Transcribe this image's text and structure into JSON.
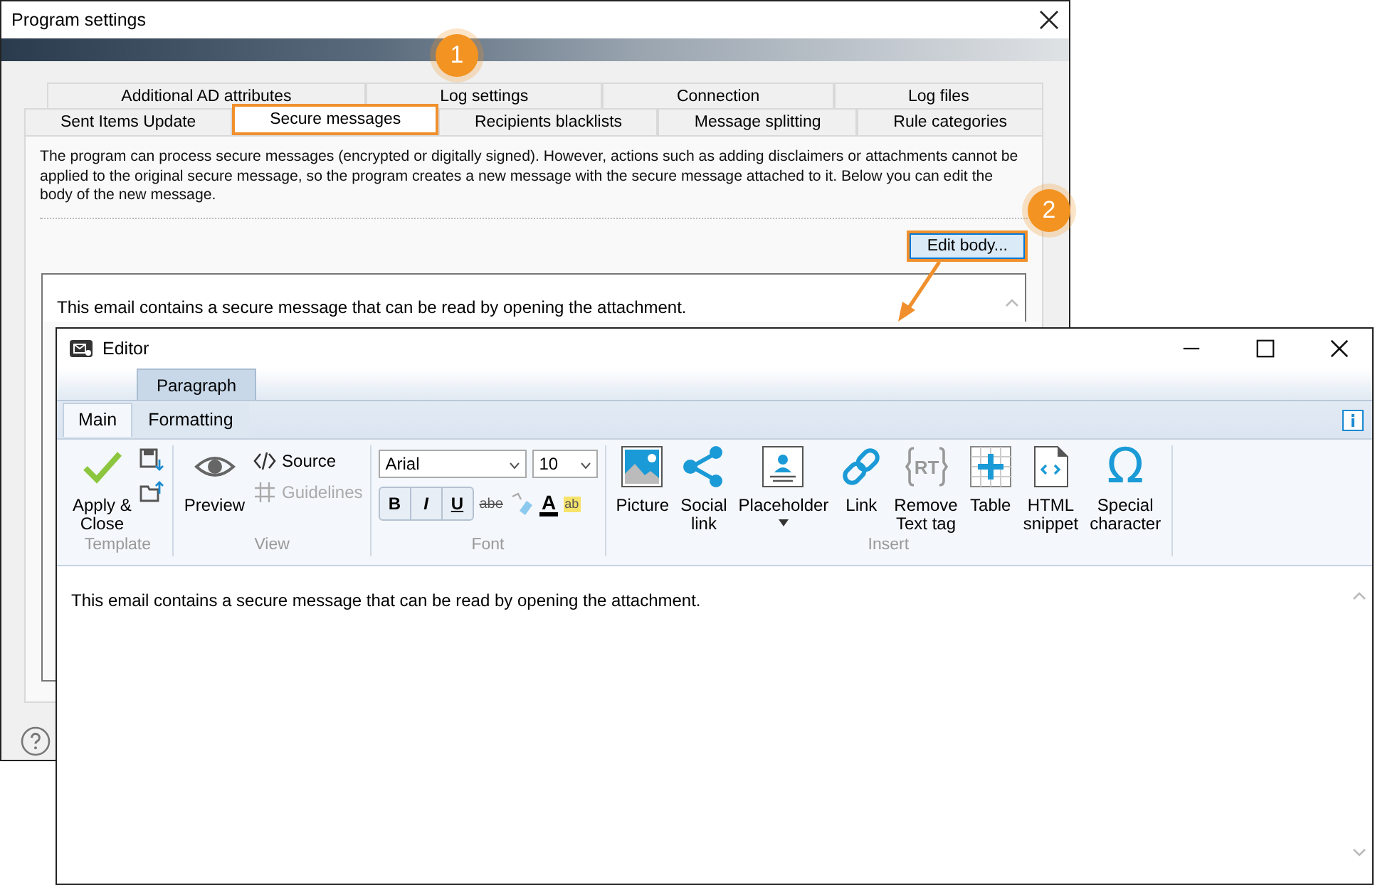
{
  "settings_window": {
    "title": "Program settings",
    "tab_rows": [
      [
        {
          "label": "Additional AD attributes",
          "selected": false
        },
        {
          "label": "Log settings",
          "selected": false
        },
        {
          "label": "Connection",
          "selected": false
        },
        {
          "label": "Log files",
          "selected": false
        }
      ],
      [
        {
          "label": "Sent Items Update",
          "selected": false
        },
        {
          "label": "Secure messages",
          "selected": true
        },
        {
          "label": "Recipients blacklists",
          "selected": false
        },
        {
          "label": "Message splitting",
          "selected": false
        },
        {
          "label": "Rule categories",
          "selected": false
        }
      ]
    ],
    "description": "The program can process secure messages (encrypted or digitally signed). However, actions such as adding disclaimers or attachments cannot be applied to the original secure message, so the program creates a new message with the secure message attached to it. Below you can edit the body of the new message.",
    "edit_button": {
      "label": "Edit body...",
      "highlighted": true
    },
    "body_preview": "This email contains a secure message that can be read by opening the attachment."
  },
  "editor_window": {
    "title": "Editor",
    "contextual_tab": "Paragraph",
    "tabs": [
      {
        "label": "Main",
        "selected": true
      },
      {
        "label": "Formatting",
        "selected": false
      }
    ],
    "groups": [
      {
        "label": "Template",
        "kind": "buttons",
        "items": [
          {
            "kind": "check",
            "label": [
              "Apply &",
              "Close"
            ]
          }
        ],
        "small_items": [
          {
            "kind": "save"
          },
          {
            "kind": "load"
          }
        ]
      },
      {
        "label": "View",
        "kind": "buttons",
        "items": [
          {
            "kind": "eye",
            "label": [
              "Preview"
            ],
            "disabled": false
          }
        ],
        "small_items": [
          {
            "kind": "code",
            "label": [
              "Source"
            ],
            "disabled": false
          },
          {
            "kind": "hash",
            "label": [
              "Guidelines"
            ],
            "disabled": true
          }
        ]
      },
      {
        "label": "Font",
        "kind": "font",
        "font": "Arial",
        "font_size": "10",
        "format": [
          "B",
          "I",
          "U"
        ],
        "strike": "abe",
        "font_color": "A",
        "highlight": "ab"
      },
      {
        "label": "Insert",
        "kind": "buttons",
        "items": [
          {
            "kind": "picture",
            "label": [
              "Picture"
            ]
          },
          {
            "kind": "share",
            "label": [
              "Social",
              "link"
            ]
          },
          {
            "kind": "placeholder",
            "label": [
              "Placeholder"
            ],
            "has_menu": true
          },
          {
            "kind": "link",
            "label": [
              "Link"
            ]
          },
          {
            "kind": "rt",
            "label": [
              "Remove",
              "Text tag"
            ],
            "icon_text": "RT"
          },
          {
            "kind": "table",
            "label": [
              "Table"
            ]
          },
          {
            "kind": "html",
            "label": [
              "HTML",
              "snippet"
            ]
          },
          {
            "kind": "omega",
            "label": [
              "Special",
              "character"
            ],
            "icon_text": "Ω"
          }
        ]
      }
    ],
    "body": "This email contains a secure message that can be read by opening the attachment."
  },
  "callouts": [
    {
      "number": "1"
    },
    {
      "number": "2"
    }
  ]
}
